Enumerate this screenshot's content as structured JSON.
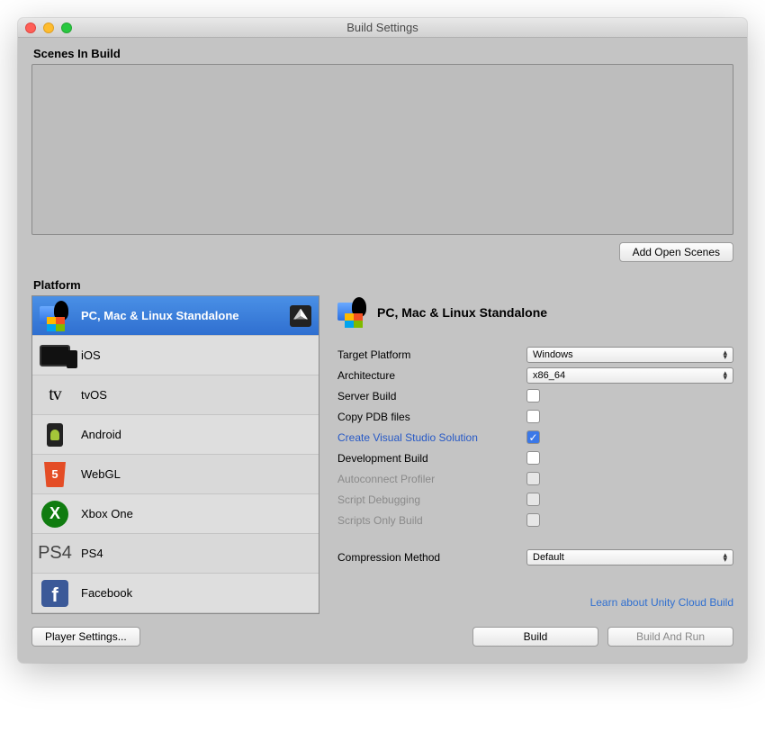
{
  "window": {
    "title": "Build Settings"
  },
  "scenes": {
    "label": "Scenes In Build",
    "add_button": "Add Open Scenes"
  },
  "platform": {
    "label": "Platform",
    "items": [
      {
        "label": "PC, Mac & Linux Standalone",
        "selected": true,
        "current": true
      },
      {
        "label": "iOS"
      },
      {
        "label": "tvOS"
      },
      {
        "label": "Android"
      },
      {
        "label": "WebGL"
      },
      {
        "label": "Xbox One"
      },
      {
        "label": "PS4"
      },
      {
        "label": "Facebook"
      }
    ]
  },
  "panel": {
    "title": "PC, Mac & Linux Standalone",
    "target_platform_label": "Target Platform",
    "target_platform_value": "Windows",
    "architecture_label": "Architecture",
    "architecture_value": "x86_64",
    "server_build_label": "Server Build",
    "copy_pdb_label": "Copy PDB files",
    "create_vs_label": "Create Visual Studio Solution",
    "dev_build_label": "Development Build",
    "autoconnect_label": "Autoconnect Profiler",
    "script_debug_label": "Script Debugging",
    "scripts_only_label": "Scripts Only Build",
    "compression_label": "Compression Method",
    "compression_value": "Default",
    "learn_link": "Learn about Unity Cloud Build"
  },
  "footer": {
    "player_settings": "Player Settings...",
    "build": "Build",
    "build_run": "Build And Run"
  }
}
